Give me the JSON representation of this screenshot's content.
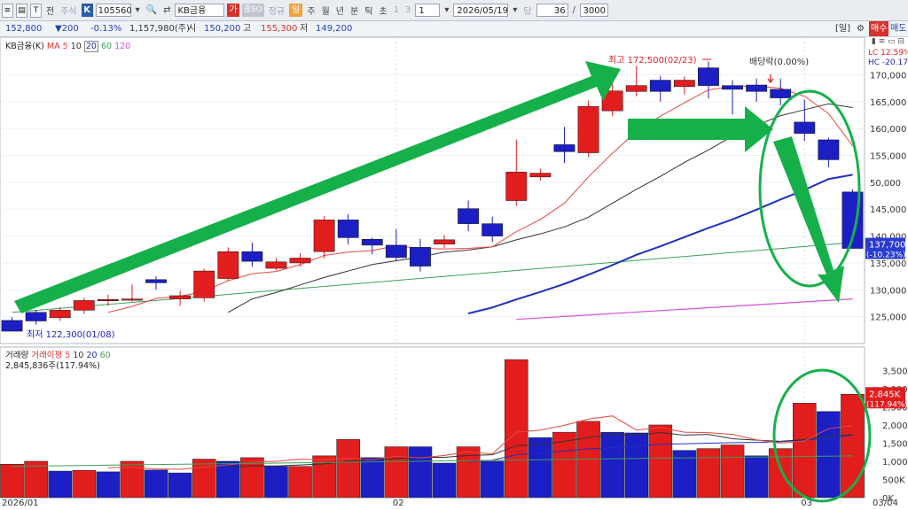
{
  "toolbar": {
    "icon1": "≡",
    "icon2": "▤",
    "t_label": "T",
    "jeon_label": "전",
    "jusik_label": "주식",
    "k_label": "K",
    "code": "105560",
    "search_icon": "🔍",
    "swap_icon": "⇄",
    "name": "KB금융",
    "ga_label": "가",
    "jeongso_label": "종SO",
    "jeonggu_label": "정규",
    "il_label": "일",
    "ju_label": "주",
    "wol_label": "월",
    "nyeon_label": "년",
    "bun_label": "분",
    "tik_label": "틱",
    "cho_label": "초",
    "n1": "1",
    "n3": "3",
    "period_value": "1",
    "date_value": "2026/05/19",
    "dang_label": "당",
    "count_value": "36",
    "slash": "/",
    "total_value": "3000"
  },
  "info": {
    "price": "152,800",
    "change": "▼200",
    "pct": "-0.13%",
    "volume": "1,157,980(주)",
    "open_label": "시",
    "open": "150,200",
    "high_label": "고",
    "high": "155,300",
    "low_label": "저",
    "low": "149,200",
    "right_tag": "[일]",
    "buy": "매수",
    "sell": "매도"
  },
  "price_legend": {
    "name": "KB금융(K)",
    "ma_label": "MA",
    "ma_periods": [
      "5",
      "10",
      "20",
      "60",
      "120"
    ]
  },
  "volume_legend": {
    "name": "거래량",
    "ma_label": "거래이평",
    "ma_periods": [
      "5",
      "10",
      "20",
      "60"
    ],
    "current": "2,845,836주(117.94%)"
  },
  "annotations": {
    "high": "최고 172,500(02/23)",
    "low": "최저 122,300(01/08)",
    "dividend": "배당락(0.00%)",
    "lc": "LC 12.59%",
    "hc": "HC -20.17%",
    "last_price": "137,700",
    "last_pct": "(-10.23%)",
    "last_vol": "2,845K",
    "last_vol_pct": "(117.94%)"
  },
  "chart_data": [
    {
      "type": "candlestick",
      "title": "KB금융(K)",
      "ylim": [
        120000,
        177000
      ],
      "y_ticks": [
        125000,
        130000,
        135000,
        140000,
        145000,
        150000,
        155000,
        160000,
        165000,
        170000
      ],
      "y_tick_labels": [
        "125,000",
        "130,000",
        "135,000",
        "140,000",
        "145,000",
        "50,000",
        "155,000",
        "160,000",
        "165,000",
        "170,000"
      ],
      "x_labels": [
        "2026/01",
        "02",
        "03",
        "03/04"
      ],
      "candles": [
        {
          "o": 124300,
          "c": 122300,
          "h": 124900,
          "l": 122300
        },
        {
          "o": 125800,
          "c": 124200,
          "h": 126200,
          "l": 123500
        },
        {
          "o": 124800,
          "c": 126200,
          "h": 126800,
          "l": 124200
        },
        {
          "o": 126200,
          "c": 128000,
          "h": 128500,
          "l": 125500
        },
        {
          "o": 128000,
          "c": 128200,
          "h": 129100,
          "l": 127000
        },
        {
          "o": 128200,
          "c": 128300,
          "h": 131000,
          "l": 127800
        },
        {
          "o": 131900,
          "c": 131300,
          "h": 132500,
          "l": 130000
        },
        {
          "o": 128300,
          "c": 128900,
          "h": 129800,
          "l": 127000
        },
        {
          "o": 128500,
          "c": 133500,
          "h": 133900,
          "l": 127800
        },
        {
          "o": 132100,
          "c": 137100,
          "h": 137900,
          "l": 131600
        },
        {
          "o": 137100,
          "c": 135300,
          "h": 138800,
          "l": 134300
        },
        {
          "o": 134000,
          "c": 135200,
          "h": 135900,
          "l": 133600
        },
        {
          "o": 135000,
          "c": 135900,
          "h": 136800,
          "l": 134300
        },
        {
          "o": 137100,
          "c": 143000,
          "h": 143700,
          "l": 135800
        },
        {
          "o": 143000,
          "c": 139700,
          "h": 144100,
          "l": 138400
        },
        {
          "o": 139400,
          "c": 138300,
          "h": 139700,
          "l": 136600
        },
        {
          "o": 138300,
          "c": 136000,
          "h": 141300,
          "l": 135300
        },
        {
          "o": 137900,
          "c": 134400,
          "h": 139500,
          "l": 133400
        },
        {
          "o": 138500,
          "c": 139300,
          "h": 140200,
          "l": 137800
        },
        {
          "o": 145100,
          "c": 142300,
          "h": 146600,
          "l": 140900
        },
        {
          "o": 142300,
          "c": 140000,
          "h": 143600,
          "l": 138900
        },
        {
          "o": 146600,
          "c": 151900,
          "h": 158000,
          "l": 145600
        },
        {
          "o": 151000,
          "c": 151700,
          "h": 152500,
          "l": 150300
        },
        {
          "o": 157000,
          "c": 155700,
          "h": 160300,
          "l": 153600
        },
        {
          "o": 155500,
          "c": 164100,
          "h": 165200,
          "l": 154700
        },
        {
          "o": 163300,
          "c": 167000,
          "h": 169300,
          "l": 162300
        },
        {
          "o": 166900,
          "c": 168000,
          "h": 171700,
          "l": 166000
        },
        {
          "o": 169000,
          "c": 166900,
          "h": 169800,
          "l": 165000
        },
        {
          "o": 167800,
          "c": 169000,
          "h": 169700,
          "l": 166400
        },
        {
          "o": 171300,
          "c": 168000,
          "h": 172500,
          "l": 165600
        },
        {
          "o": 168000,
          "c": 167300,
          "h": 169000,
          "l": 162600
        },
        {
          "o": 168100,
          "c": 166900,
          "h": 169300,
          "l": 165000
        },
        {
          "o": 167300,
          "c": 165700,
          "h": 169300,
          "l": 164300
        },
        {
          "o": 161200,
          "c": 159100,
          "h": 165400,
          "l": 157700
        },
        {
          "o": 157900,
          "c": 154200,
          "h": 158300,
          "l": 152800
        },
        {
          "o": 148200,
          "c": 137700,
          "h": 148700,
          "l": 137700
        }
      ],
      "series": [
        {
          "name": "5",
          "values": [
            null,
            null,
            null,
            null,
            125800,
            126900,
            128400,
            128800,
            129700,
            131700,
            133000,
            133400,
            134700,
            136400,
            137000,
            137300,
            138200,
            137700,
            137600,
            137700,
            138000,
            140800,
            143100,
            146100,
            151000,
            155400,
            159400,
            162300,
            164800,
            167200,
            167800,
            167900,
            167500,
            166000,
            162800,
            156800
          ]
        },
        {
          "name": "10",
          "values": [
            null,
            null,
            null,
            null,
            null,
            null,
            null,
            null,
            null,
            125800,
            128300,
            129500,
            130900,
            132300,
            133500,
            134700,
            135400,
            136100,
            137000,
            137400,
            138000,
            139300,
            140400,
            141700,
            143500,
            146100,
            148700,
            151100,
            153700,
            156000,
            158600,
            160600,
            162400,
            163500,
            164600,
            163900
          ]
        },
        {
          "name": "20",
          "values": [
            null,
            null,
            null,
            null,
            null,
            null,
            null,
            null,
            null,
            null,
            null,
            null,
            null,
            null,
            null,
            null,
            null,
            null,
            null,
            125600,
            126700,
            128200,
            129600,
            131100,
            132800,
            134600,
            136500,
            138100,
            139800,
            141500,
            143100,
            144900,
            146800,
            148600,
            150600,
            151400
          ]
        },
        {
          "name": "60",
          "values": [
            null,
            null,
            null,
            null,
            null,
            null,
            null,
            null,
            null,
            null,
            null,
            null,
            null,
            null,
            null,
            null,
            null,
            null,
            null,
            null,
            null,
            null,
            null,
            null,
            null,
            null,
            null,
            null,
            null,
            null,
            null,
            null,
            null,
            null,
            null,
            138800
          ]
        },
        {
          "name": "120",
          "values": [
            null,
            null,
            null,
            null,
            null,
            null,
            null,
            null,
            null,
            null,
            null,
            null,
            null,
            null,
            null,
            null,
            null,
            null,
            null,
            null,
            null,
            null,
            null,
            null,
            null,
            null,
            null,
            null,
            null,
            null,
            null,
            null,
            null,
            null,
            null,
            128300
          ]
        }
      ],
      "ma60_line": {
        "x": [
          0,
          35
        ],
        "y": [
          125800,
          138800
        ]
      },
      "ma120_line": {
        "x": [
          21,
          35
        ],
        "y": [
          124500,
          128300
        ]
      },
      "ma_colors": {
        "5": "#e8463f",
        "10": "#333333",
        "20": "#1f2fbf",
        "60": "#3aa05a",
        "120": "#d54fd6"
      }
    },
    {
      "type": "bar",
      "title": "거래량",
      "ylim": [
        0,
        3900
      ],
      "unit": "K",
      "y_ticks": [
        0,
        500,
        1000,
        1500,
        2000,
        2500,
        3000,
        3500
      ],
      "y_tick_labels": [
        "0K",
        "500K",
        "1,000K",
        "1,500K",
        "2,000K",
        "2,500K",
        "3,000K",
        "3,500K"
      ],
      "values": [
        920,
        1000,
        730,
        750,
        710,
        1000,
        760,
        680,
        1060,
        1000,
        1100,
        860,
        860,
        1150,
        1600,
        1100,
        1400,
        1400,
        950,
        1400,
        1000,
        3800,
        1650,
        1800,
        2100,
        1800,
        1780,
        2000,
        1300,
        1350,
        1450,
        1150,
        1350,
        2600,
        2370,
        2845
      ],
      "colors": [
        "red",
        "red",
        "blue",
        "red",
        "blue",
        "red",
        "blue",
        "blue",
        "red",
        "blue",
        "red",
        "blue",
        "red",
        "red",
        "red",
        "blue",
        "red",
        "blue",
        "blue",
        "red",
        "blue",
        "red",
        "blue",
        "red",
        "red",
        "blue",
        "blue",
        "red",
        "blue",
        "red",
        "red",
        "blue",
        "red",
        "red",
        "blue",
        "red"
      ],
      "series": [
        {
          "name": "5",
          "values": [
            null,
            null,
            null,
            null,
            822,
            838,
            790,
            780,
            842,
            900,
            980,
            1000,
            1060,
            1040,
            1080,
            1040,
            1140,
            1090,
            1160,
            1260,
            1200,
            1800,
            1860,
            1990,
            2160,
            2250,
            1860,
            1930,
            1800,
            1790,
            1740,
            1590,
            1500,
            1560,
            1900,
            1980
          ]
        },
        {
          "name": "10",
          "values": [
            null,
            null,
            null,
            null,
            null,
            null,
            null,
            null,
            null,
            840,
            870,
            870,
            900,
            930,
            1000,
            1050,
            1080,
            1110,
            1110,
            1160,
            1180,
            1430,
            1460,
            1550,
            1650,
            1740,
            1710,
            1790,
            1720,
            1740,
            1620,
            1580,
            1550,
            1600,
            1700,
            1730
          ]
        },
        {
          "name": "20",
          "values": [
            null,
            null,
            null,
            null,
            null,
            null,
            null,
            null,
            null,
            null,
            null,
            null,
            null,
            null,
            null,
            null,
            null,
            null,
            null,
            1000,
            1030,
            1180,
            1230,
            1280,
            1340,
            1380,
            1420,
            1470,
            1480,
            1500,
            1510,
            1520,
            1540,
            1580,
            1620,
            1720
          ]
        }
      ]
    }
  ]
}
